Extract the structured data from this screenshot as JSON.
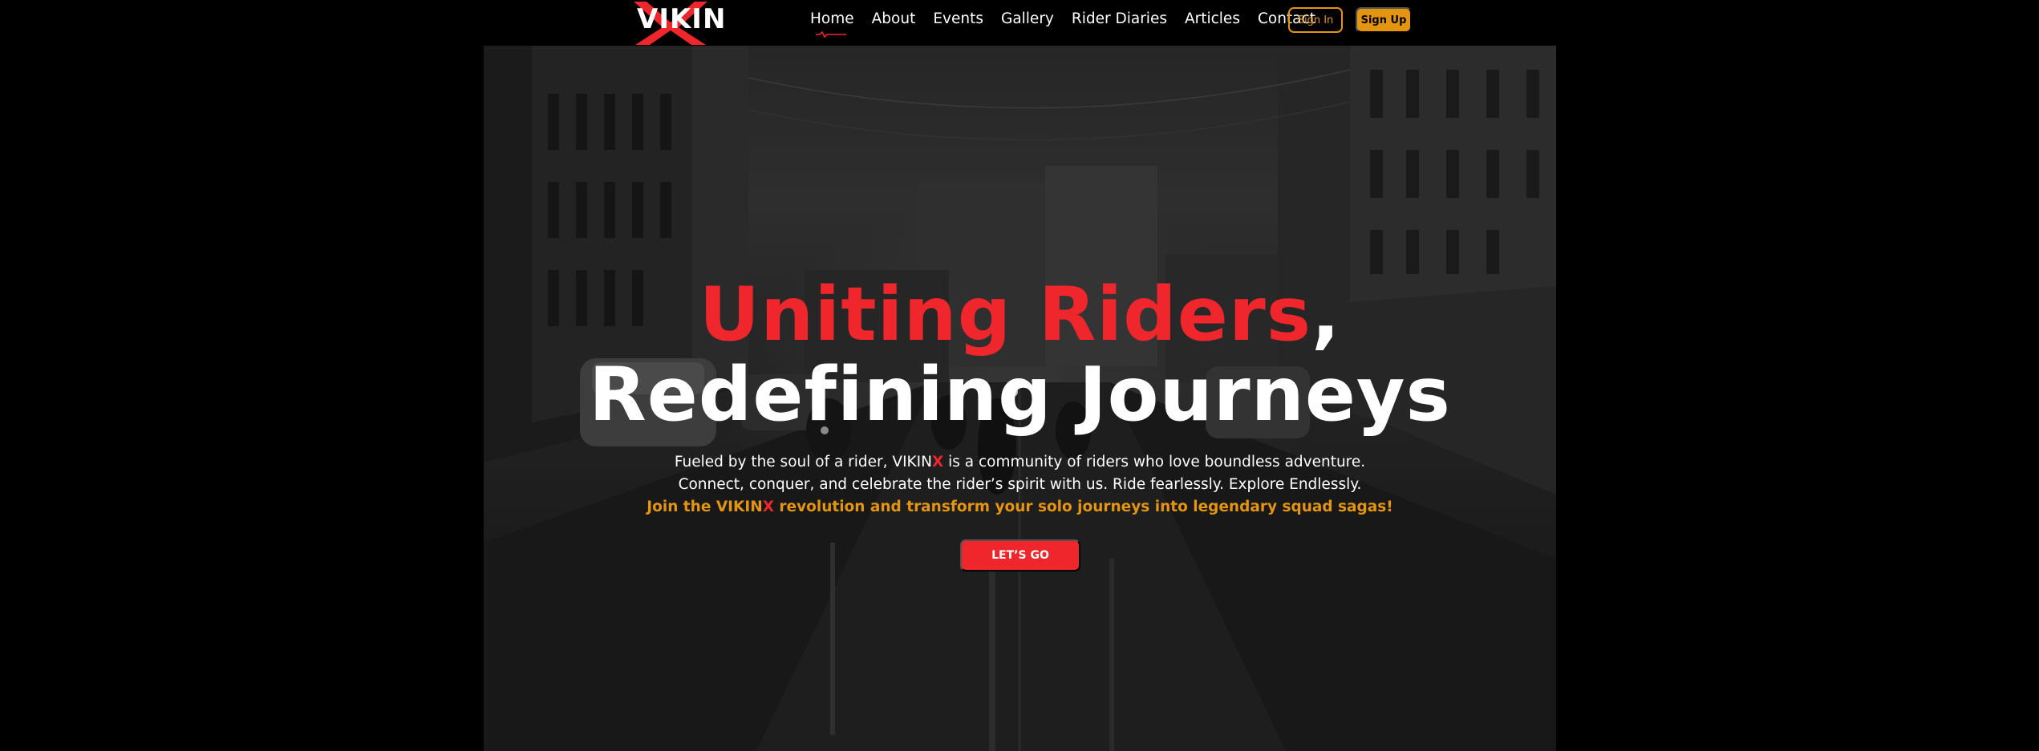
{
  "brand": {
    "logo_text": "VIKIN",
    "accent_red": "#f0262d",
    "accent_orange": "#e3950f"
  },
  "nav": {
    "items": [
      {
        "label": "Home",
        "active": true
      },
      {
        "label": "About"
      },
      {
        "label": "Events"
      },
      {
        "label": "Gallery"
      },
      {
        "label": "Rider Diaries"
      },
      {
        "label": "Articles"
      },
      {
        "label": "Contact"
      }
    ],
    "signin_label": "Sign In",
    "signup_label": "Sign Up"
  },
  "hero": {
    "headline_red": "Uniting Riders",
    "headline_white": ", Redefining Journeys",
    "line1_a": "Fueled by the soul of a rider, VIKIN",
    "line1_x": "X",
    "line1_b": " is a community of riders who love boundless adventure.",
    "line2": "Connect, conquer, and celebrate the rider’s spirit with us. Ride fearlessly. Explore Endlessly.",
    "line3_a": "Join the VIKIN",
    "line3_x": "X",
    "line3_b": " revolution and transform your solo journeys into legendary squad sagas!",
    "cta_label": "LET’S GO"
  }
}
